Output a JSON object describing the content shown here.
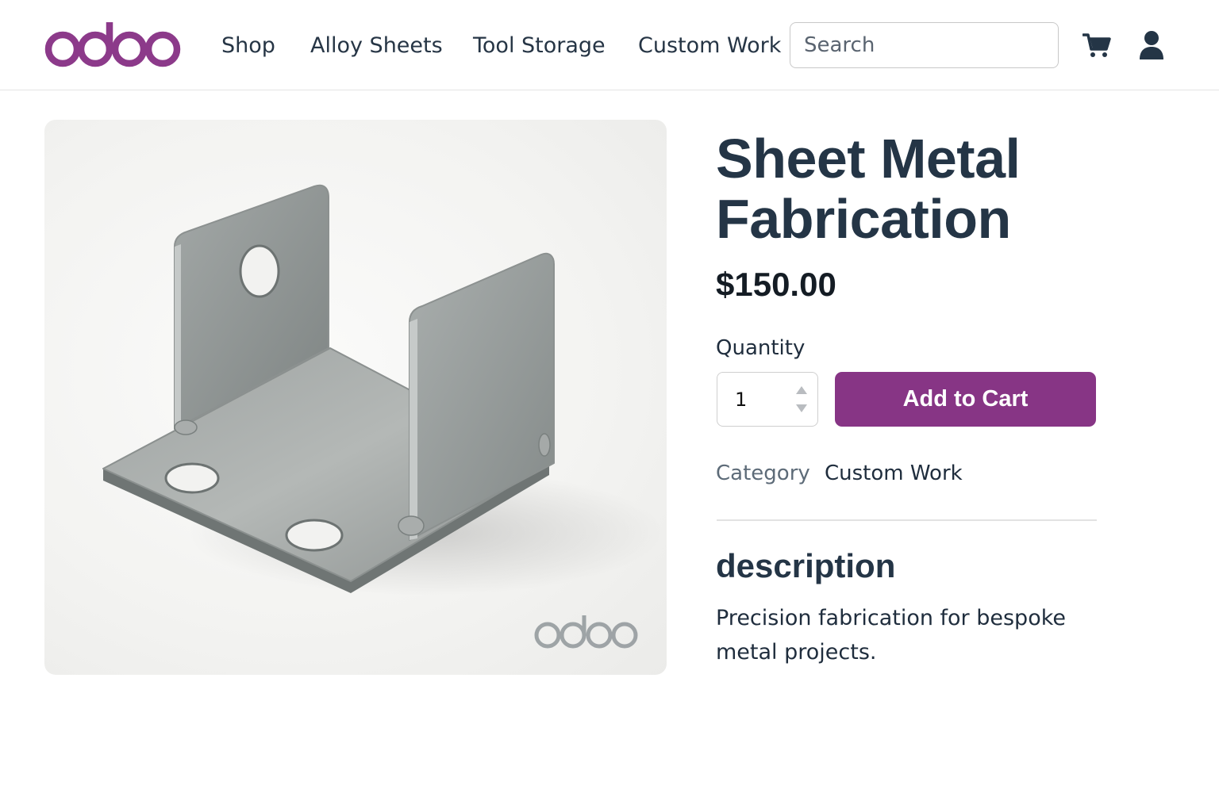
{
  "header": {
    "logo_text": "odoo",
    "nav": [
      {
        "label": "Shop"
      },
      {
        "label": "Alloy Sheets"
      },
      {
        "label": "Tool Storage"
      },
      {
        "label": "Custom Work"
      }
    ],
    "search": {
      "placeholder": "Search",
      "value": ""
    },
    "icons": {
      "cart": "shopping-cart-icon",
      "account": "user-icon"
    }
  },
  "product": {
    "image_alt": "Sheet metal U-bracket",
    "watermark": "odoo",
    "title": "Sheet Metal Fabrication",
    "price": "$150.00",
    "quantity_label": "Quantity",
    "quantity_value": "1",
    "add_to_cart_label": "Add to Cart",
    "category_label": "Category",
    "category_value": "Custom Work",
    "description_heading": "description",
    "description_text": "Precision fabrication for bespoke metal projects."
  },
  "colors": {
    "brand": "#873585",
    "heading": "#243546",
    "text": "#1f2d3d"
  }
}
